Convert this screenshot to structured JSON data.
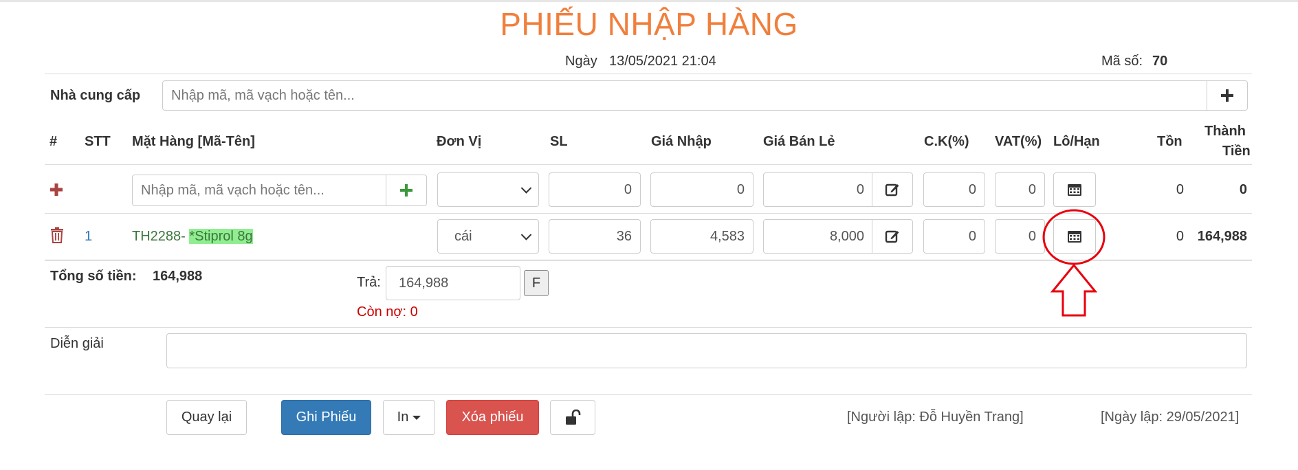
{
  "title": "PHIẾU NHẬP HÀNG",
  "header": {
    "date_label": "Ngày",
    "date_value": "13/05/2021 21:04",
    "code_label": "Mã số:",
    "code_value": "70"
  },
  "supplier": {
    "label": "Nhà cung cấp",
    "placeholder": "Nhập mã, mã vạch hoặc tên..."
  },
  "table": {
    "headers": {
      "hash": "#",
      "stt": "STT",
      "item": "Mặt Hàng [Mã-Tên]",
      "unit": "Đơn Vị",
      "qty": "SL",
      "import_price": "Giá Nhập",
      "retail_price": "Giá Bán Lẻ",
      "discount": "C.K(%)",
      "vat": "VAT(%)",
      "lot": "Lô/Hạn",
      "stock": "Tồn",
      "total_1": "Thành",
      "total_2": "Tiền"
    },
    "new_row": {
      "item_placeholder": "Nhập mã, mã vạch hoặc tên...",
      "unit": "",
      "qty": "0",
      "import_price": "0",
      "retail_price": "0",
      "discount": "0",
      "vat": "0",
      "stock": "0",
      "total": "0"
    },
    "rows": [
      {
        "stt": "1",
        "item_code": "TH2288- ",
        "item_name": "*Stiprol 8g",
        "unit": "cái",
        "qty": "36",
        "import_price": "4,583",
        "retail_price": "8,000",
        "discount": "0",
        "vat": "0",
        "stock": "0",
        "total": "164,988"
      }
    ]
  },
  "summary": {
    "total_label": "Tổng số tiền:",
    "total_value": "164,988",
    "pay_label": "Trả:",
    "pay_value": "164,988",
    "pay_button": "F",
    "debt_text": "Còn nợ: 0"
  },
  "note": {
    "label": "Diễn giải",
    "value": ""
  },
  "actions": {
    "back": "Quay lại",
    "save": "Ghi Phiếu",
    "print": "In",
    "delete": "Xóa phiếu"
  },
  "footer": {
    "creator": "[Người lập: Đỗ Huyền Trang]",
    "created_date": "[Ngày lập: 29/05/2021]"
  },
  "colors": {
    "title": "#f07f3c",
    "primary": "#337ab7",
    "danger": "#d9534f",
    "item_code": "#3c763d",
    "highlight": "#90ee90",
    "debt": "#cc0000",
    "annotation": "#e8000d"
  },
  "icons": {
    "add_supplier": "plus-icon",
    "add_item": "plus-icon",
    "new_row": "plus-icon",
    "delete_row": "trash-icon",
    "edit_price": "edit-icon",
    "lot_date": "calendar-icon",
    "lock": "unlock-icon"
  }
}
